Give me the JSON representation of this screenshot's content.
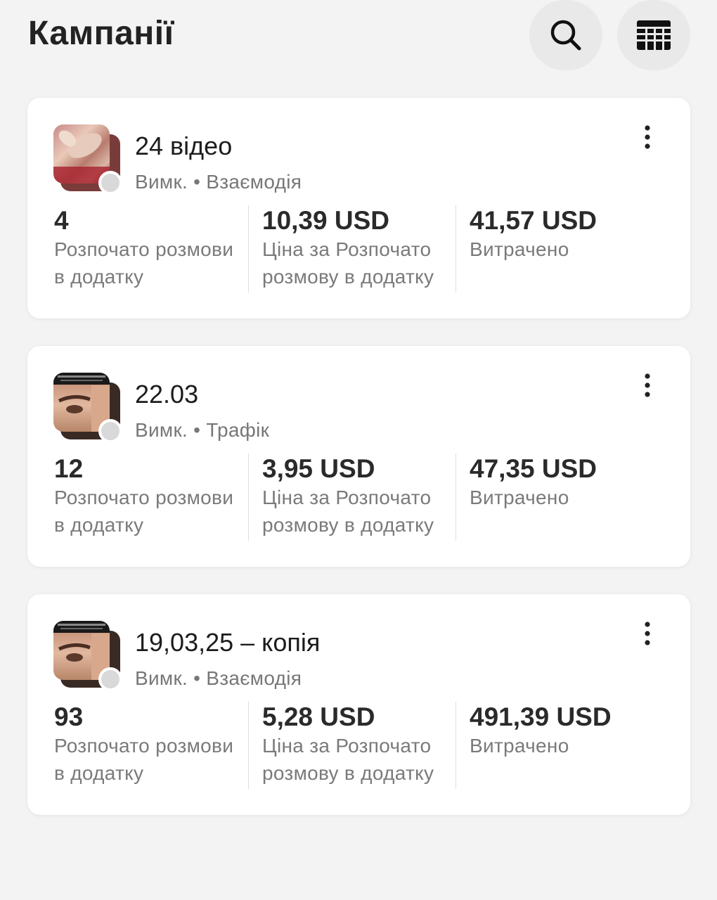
{
  "header": {
    "title": "Кампанії",
    "search_icon": "search-icon",
    "table_icon": "table-view-icon"
  },
  "campaigns": [
    {
      "name": "24 відео",
      "status": "Вимк.",
      "separator": "•",
      "objective": "Взаємодія",
      "status_color": "#d9d9d9",
      "thumbnail": "pink-satin-image",
      "metrics": [
        {
          "value": "4",
          "label": "Розпочато розмови в додатку"
        },
        {
          "value": "10,39 USD",
          "label": "Ціна за Розпочато розмову в додатку"
        },
        {
          "value": "41,57 USD",
          "label": "Витрачено"
        }
      ]
    },
    {
      "name": "22.03",
      "status": "Вимк.",
      "separator": "•",
      "objective": "Трафік",
      "status_color": "#d9d9d9",
      "thumbnail": "brow-closeup-image",
      "metrics": [
        {
          "value": "12",
          "label": "Розпочато розмови в додатку"
        },
        {
          "value": "3,95 USD",
          "label": "Ціна за Розпочато розмову в додатку"
        },
        {
          "value": "47,35 USD",
          "label": "Витрачено"
        }
      ]
    },
    {
      "name": "19,03,25 – копія",
      "status": "Вимк.",
      "separator": "•",
      "objective": "Взаємодія",
      "status_color": "#d9d9d9",
      "thumbnail": "brow-closeup-image",
      "metrics": [
        {
          "value": "93",
          "label": "Розпочато розмови в додатку"
        },
        {
          "value": "5,28 USD",
          "label": "Ціна за Розпочато розмову в додатку"
        },
        {
          "value": "491,39 USD",
          "label": "Витрачено"
        }
      ]
    }
  ]
}
